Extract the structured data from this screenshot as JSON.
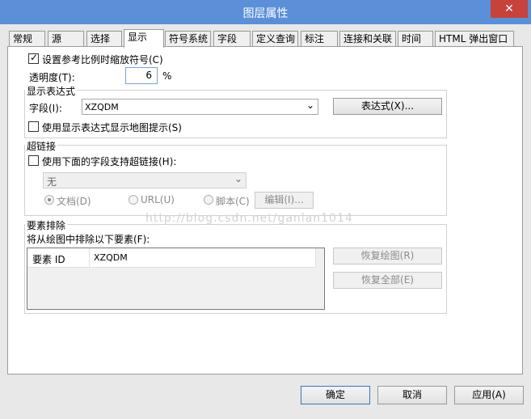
{
  "window": {
    "title": "图层属性",
    "close_glyph": "✕"
  },
  "tabs": [
    {
      "label": "常规"
    },
    {
      "label": "源"
    },
    {
      "label": "选择"
    },
    {
      "label": "显示",
      "active": true
    },
    {
      "label": "符号系统"
    },
    {
      "label": "字段"
    },
    {
      "label": "定义查询"
    },
    {
      "label": "标注"
    },
    {
      "label": "连接和关联"
    },
    {
      "label": "时间"
    },
    {
      "label": "HTML 弹出窗口"
    }
  ],
  "display": {
    "scale_symbols_label": "设置参考比例时缩放符号(C)",
    "scale_symbols_checked": true,
    "transparency_label": "透明度(T):",
    "transparency_value": "6",
    "transparency_unit": "%"
  },
  "expression": {
    "group_title": "显示表达式",
    "field_label": "字段(I):",
    "field_value": "XZQDM",
    "expression_button": "表达式(X)...",
    "maptips_label": "使用显示表达式显示地图提示(S)",
    "maptips_checked": false
  },
  "hyperlink": {
    "group_title": "超链接",
    "support_label": "使用下面的字段支持超链接(H):",
    "support_checked": false,
    "field_value": "无",
    "type_document": "文档(D)",
    "type_url": "URL(U)",
    "type_script": "脚本(C)",
    "edit_button": "编辑(I)..."
  },
  "exclusion": {
    "group_title": "要素排除",
    "list_label": "将从绘图中排除以下要素(F):",
    "columns": [
      "要素 ID",
      "XZQDM"
    ],
    "restore_draw_button": "恢复绘图(R)",
    "restore_all_button": "恢复全部(E)"
  },
  "watermark": "http://blog.csdn.net/ganlan1014",
  "footer": {
    "ok": "确定",
    "cancel": "取消",
    "apply": "应用(A)"
  },
  "colors": {
    "titlebar": "#5b8fd8",
    "close": "#c7423a",
    "focus": "#3a73c4"
  },
  "icons": {
    "dropdown": "chevron-down-icon",
    "checkmark": "check-icon"
  }
}
